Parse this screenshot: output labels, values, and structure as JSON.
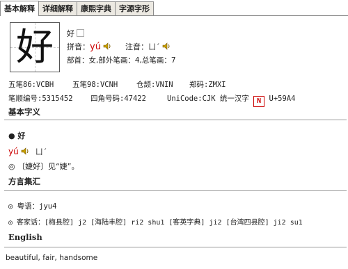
{
  "tabs": [
    {
      "label": "基本解释"
    },
    {
      "label": "详细解释"
    },
    {
      "label": "康熙字典"
    },
    {
      "label": "字源字形"
    }
  ],
  "entry": {
    "char": "好",
    "small_char": "好",
    "pinyin_label": "拼音：",
    "pinyin": "yú",
    "zhuyin_label": "注音：",
    "zhuyin": "ㄩˊ",
    "radical": "部首：女,部外笔画：4,总笔画：7"
  },
  "codes": {
    "wubi86": "五笔86:VCBH",
    "wubi98": "五笔98:VCNH",
    "cangjie": "仓颉:VNIN",
    "zhengma": "郑码:ZMXI",
    "stroke_no": "笔顺编号:5315452",
    "four_corner": "四角号码:47422",
    "unicode_desc": "UniCode:CJK 统一汉字",
    "unicode_val": "U+59A4",
    "unicode_icon": "N"
  },
  "basic": {
    "heading": "基本字义",
    "bullet_char": "● 好",
    "pinyin": "yú",
    "zhuyin": "ㄩˊ",
    "definition": "◎ 〔婕好〕见“婕”。"
  },
  "dialect": {
    "heading": "方言集汇",
    "cantonese": "◎ 粤语：jyu4",
    "hakka": "◎ 客家话：[梅县腔] j2 [海陆丰腔] ri2 shu1 [客英字典] ji2 [台湾四县腔] ji2 su1"
  },
  "english": {
    "heading": "English",
    "text": "beautiful, fair, handsome"
  }
}
